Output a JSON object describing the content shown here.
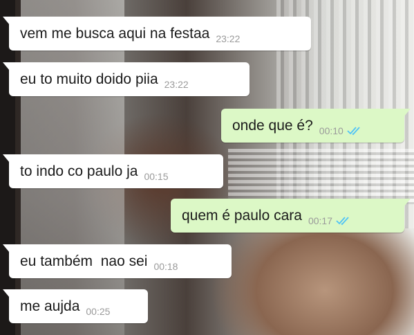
{
  "colors": {
    "incoming_bubble": "#ffffff",
    "outgoing_bubble": "#dcf8c6",
    "read_ticks": "#4fc3f7",
    "timestamp": "#9a9a9a"
  },
  "messages": [
    {
      "direction": "incoming",
      "text": "vem me busca aqui na festaa",
      "time": "23:22"
    },
    {
      "direction": "incoming",
      "text": "eu to muito doido piia",
      "time": "23:22"
    },
    {
      "direction": "outgoing",
      "text": "onde que é?",
      "time": "00:10",
      "status_icon": "double-check-read-icon"
    },
    {
      "direction": "incoming",
      "text": "to indo co paulo ja",
      "time": "00:15"
    },
    {
      "direction": "outgoing",
      "text": "quem é paulo cara",
      "time": "00:17",
      "status_icon": "double-check-read-icon"
    },
    {
      "direction": "incoming",
      "text": "eu também  nao sei",
      "time": "00:18"
    },
    {
      "direction": "incoming",
      "text": "me aujda",
      "time": "00:25"
    }
  ]
}
